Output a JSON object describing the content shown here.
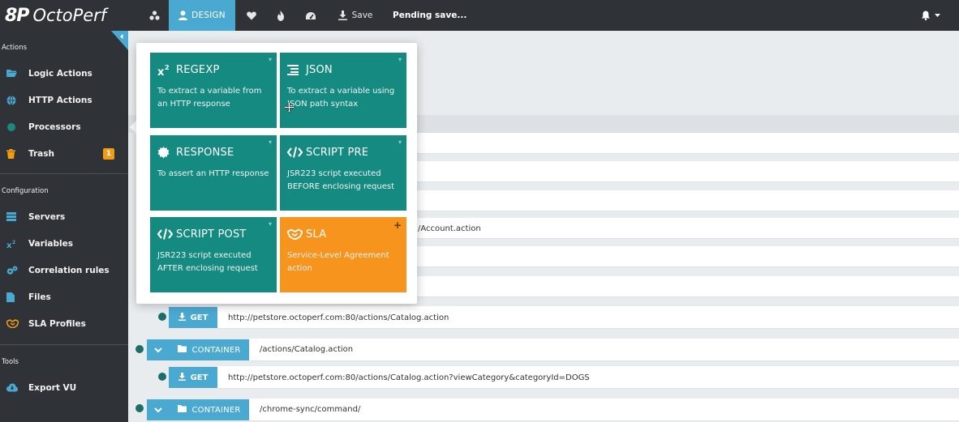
{
  "app": {
    "logo_mark": "8P",
    "logo_text": "OctoPerf"
  },
  "topbar": {
    "design_label": "DESIGN",
    "save_label": "Save",
    "status_text": "Pending save..."
  },
  "sidebar": {
    "sections": [
      {
        "title": "Actions"
      },
      {
        "title": "Configuration"
      },
      {
        "title": "Tools"
      }
    ],
    "items": [
      {
        "label": "Logic Actions"
      },
      {
        "label": "HTTP Actions"
      },
      {
        "label": "Processors"
      },
      {
        "label": "Trash",
        "badge": "1"
      },
      {
        "label": "Servers"
      },
      {
        "label": "Variables"
      },
      {
        "label": "Correlation rules"
      },
      {
        "label": "Files"
      },
      {
        "label": "SLA Profiles"
      },
      {
        "label": "Export VU"
      }
    ]
  },
  "popover": {
    "tiles": [
      {
        "title": "REGEXP",
        "desc": "To extract a variable from an HTTP response",
        "icon": "superscript-icon"
      },
      {
        "title": "JSON",
        "desc": "To extract a variable using JSON path syntax",
        "icon": "list-icon"
      },
      {
        "title": "RESPONSE",
        "desc": "To assert an HTTP response",
        "icon": "badge-icon"
      },
      {
        "title": "SCRIPT PRE",
        "desc": "JSR223 script executed BEFORE enclosing request",
        "icon": "code-icon"
      },
      {
        "title": "SCRIPT POST",
        "desc": "JSR223 script executed AFTER enclosing request",
        "icon": "code-icon"
      },
      {
        "title": "SLA",
        "desc": "Service-Level Agreement action",
        "icon": "handshake-icon",
        "corner": "+"
      }
    ]
  },
  "list": {
    "partial_url": "/Account.action",
    "rows": [
      {
        "type": "GET",
        "url": "http://petstore.octoperf.com:80/actions/Catalog.action"
      },
      {
        "type": "CONTAINER",
        "url": "/actions/Catalog.action"
      },
      {
        "type": "GET",
        "url": "http://petstore.octoperf.com:80/actions/Catalog.action?viewCategory&categoryId=DOGS"
      },
      {
        "type": "CONTAINER",
        "url": "/chrome-sync/command/"
      }
    ]
  },
  "colors": {
    "topbar": "#2f3338",
    "accent": "#4aa9d1",
    "tile_teal": "#148a80",
    "tile_orange": "#f7941d",
    "badge": "#f39c12",
    "dot": "#1c6e68"
  }
}
